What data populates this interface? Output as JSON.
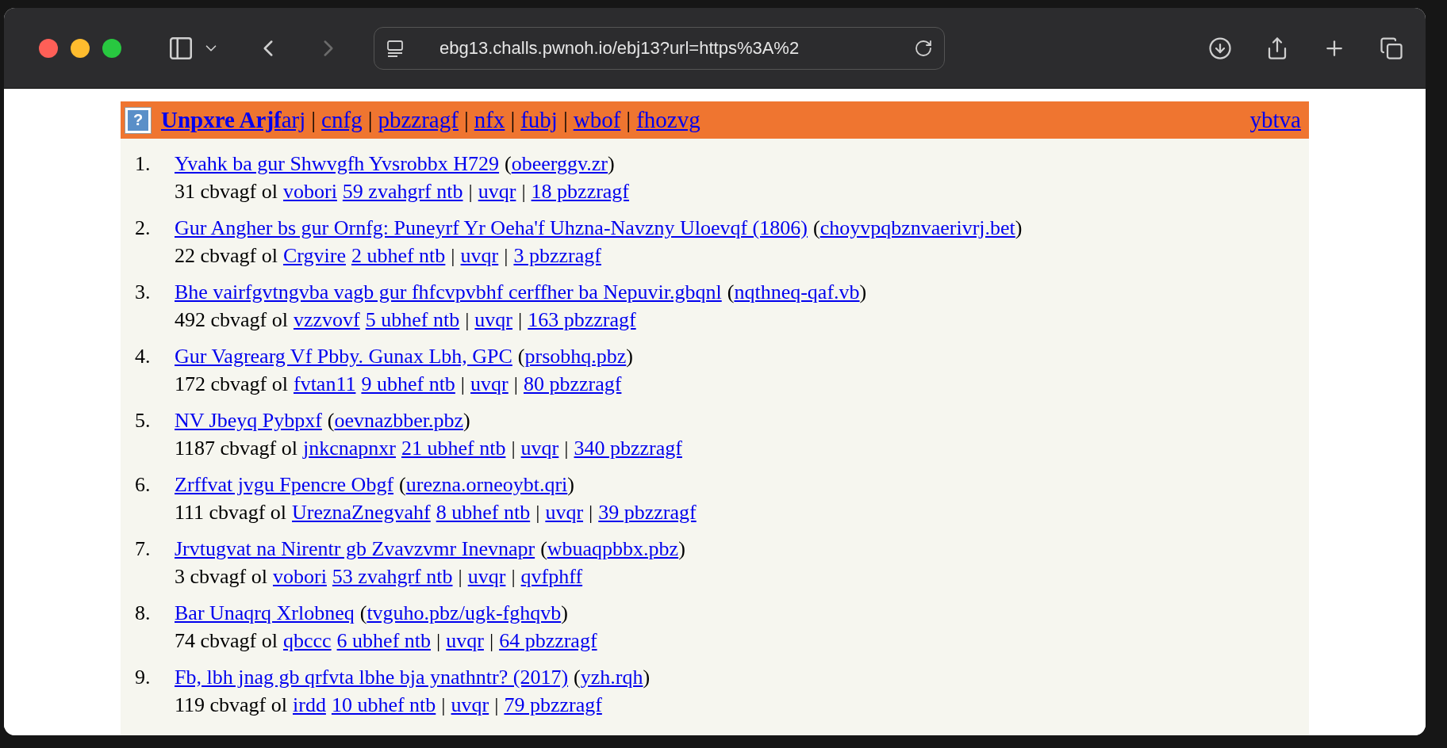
{
  "browser": {
    "url": "ebg13.challs.pwnoh.io/ebj13?url=https%3A%2",
    "buttons": [
      {
        "kind": "sidebar",
        "disabled": false
      },
      {
        "kind": "tab-menu",
        "disabled": false
      },
      {
        "kind": "back",
        "disabled": false
      },
      {
        "kind": "forward",
        "disabled": true
      }
    ],
    "actions": [
      {
        "kind": "download",
        "disabled": false
      },
      {
        "kind": "share",
        "disabled": false
      },
      {
        "kind": "new-tab",
        "disabled": false
      },
      {
        "kind": "tabs",
        "disabled": false
      }
    ]
  },
  "header": {
    "logo_glyph": "?",
    "brand": "Unpxre Arjf",
    "brand_suffix": "arj",
    "links": [
      "cnfg",
      "pbzzragf",
      "nfx",
      "fubj",
      "wbof",
      "fhozvg"
    ],
    "separator": "|",
    "paren_open": "(",
    "paren_close": ")",
    "login": "ybtva"
  },
  "stories": [
    {
      "rank": "1.",
      "title": "Yvahk ba gur Shwvgfh Yvsrobbx H729",
      "site": "obeerggv.zr",
      "points": "31 cbvagf ol",
      "user": "vobori",
      "age": "59 zvahgrf ntb",
      "hide": "uvqr",
      "comments": "18 pbzzragf"
    },
    {
      "rank": "2.",
      "title": "Gur Angher bs gur Ornfg: Puneyrf Yr Oeha'f Uhzna-Navzny Uloevqf (1806)",
      "site": "choyvpqbznvaerivrj.bet",
      "points": "22 cbvagf ol",
      "user": "Crgvire",
      "age": "2 ubhef ntb",
      "hide": "uvqr",
      "comments": "3 pbzzragf"
    },
    {
      "rank": "3.",
      "title": "Bhe vairfgvtngvba vagb gur fhfcvpvbhf cerffher ba Nepuvir.gbqnl",
      "site": "nqthneq-qaf.vb",
      "points": "492 cbvagf ol",
      "user": "vzzvovf",
      "age": "5 ubhef ntb",
      "hide": "uvqr",
      "comments": "163 pbzzragf"
    },
    {
      "rank": "4.",
      "title": "Gur Vagrearg Vf Pbby. Gunax Lbh, GPC",
      "site": "prsobhq.pbz",
      "points": "172 cbvagf ol",
      "user": "fvtan11",
      "age": "9 ubhef ntb",
      "hide": "uvqr",
      "comments": "80 pbzzragf"
    },
    {
      "rank": "5.",
      "title": "NV Jbeyq Pybpxf",
      "site": "oevnazbber.pbz",
      "points": "1187 cbvagf ol",
      "user": "jnkcnapnxr",
      "age": "21 ubhef ntb",
      "hide": "uvqr",
      "comments": "340 pbzzragf"
    },
    {
      "rank": "6.",
      "title": "Zrffvat jvgu Fpencre Obgf",
      "site": "urezna.orneoybt.qri",
      "points": "111 cbvagf ol",
      "user": "UreznaZnegvahf",
      "age": "8 ubhef ntb",
      "hide": "uvqr",
      "comments": "39 pbzzragf"
    },
    {
      "rank": "7.",
      "title": "Jrvtugvat na Nirentr gb Zvavzvmr Inevnapr",
      "site": "wbuaqpbbx.pbz",
      "points": "3 cbvagf ol",
      "user": "vobori",
      "age": "53 zvahgrf ntb",
      "hide": "uvqr",
      "comments": "qvfphff"
    },
    {
      "rank": "8.",
      "title": "Bar Unaqrq Xrlobneq",
      "site": "tvguho.pbz/ugk-fghqvb",
      "points": "74 cbvagf ol",
      "user": "qbccc",
      "age": "6 ubhef ntb",
      "hide": "uvqr",
      "comments": "64 pbzzragf"
    },
    {
      "rank": "9.",
      "title": "Fb, lbh jnag gb qrfvta lbhe bja ynathntr? (2017)",
      "site": "yzh.rqh",
      "points": "119 cbvagf ol",
      "user": "irdd",
      "age": "10 ubhef ntb",
      "hide": "uvqr",
      "comments": "79 pbzzragf"
    }
  ]
}
